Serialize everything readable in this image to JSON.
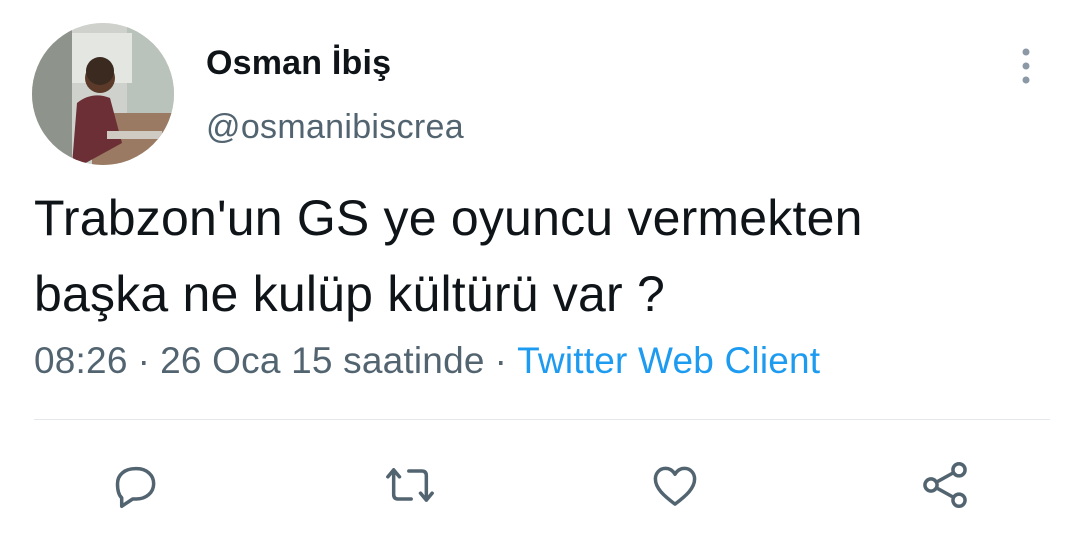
{
  "tweet": {
    "author": {
      "display_name": "Osman İbiş",
      "handle": "@osmanibiscrea"
    },
    "text_line1": "Trabzon'un GS ye oyuncu vermekten",
    "text_line2": "başka ne kulüp kültürü var ?",
    "time": "08:26",
    "date": "26 Oca 15 saatinde",
    "separator": "·",
    "source": "Twitter Web Client"
  },
  "icons": {
    "more": "more-vertical-icon",
    "reply": "reply-icon",
    "retweet": "retweet-icon",
    "like": "heart-icon",
    "share": "share-icon"
  },
  "colors": {
    "text": "#0f1419",
    "muted": "#536471",
    "link": "#1d9bf0",
    "divider": "#e6e9ec"
  }
}
